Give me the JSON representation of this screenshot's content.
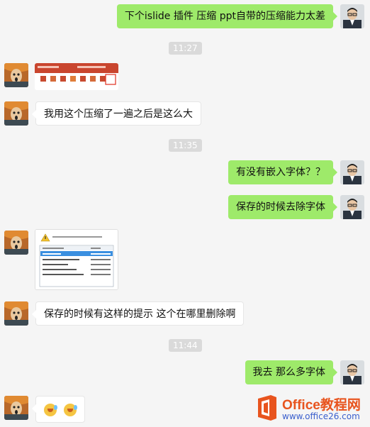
{
  "messages": [
    {
      "side": "me",
      "type": "text",
      "text": "下个islide 插件 压缩 ppt自带的压缩能力太差"
    },
    {
      "type": "time",
      "text": "11:27"
    },
    {
      "side": "other",
      "type": "image",
      "image": "powerpoint-toolbar-screenshot"
    },
    {
      "side": "other",
      "type": "text",
      "text": "我用这个压缩了一遍之后是这么大"
    },
    {
      "type": "time",
      "text": "11:35"
    },
    {
      "side": "me",
      "type": "text",
      "text": "有没有嵌入字体？？"
    },
    {
      "side": "me",
      "type": "text",
      "text": "保存的时候去除字体"
    },
    {
      "side": "other",
      "type": "image",
      "image": "font-warning-dialog-screenshot"
    },
    {
      "side": "other",
      "type": "text",
      "text": "保存的时候有这样的提示 这个在哪里删除啊"
    },
    {
      "type": "time",
      "text": "11:44"
    },
    {
      "side": "me",
      "type": "text",
      "text": "我去 那么多字体"
    },
    {
      "side": "other",
      "type": "emoji",
      "emojis": [
        "grinning-tears-icon",
        "grinning-tears-icon"
      ]
    }
  ],
  "watermark": {
    "logo_icon": "office-logo-icon",
    "title": "Office教程网",
    "url": "www.office26.com",
    "colors": {
      "orange": "#e8541e",
      "blue": "#3a5fcd"
    }
  },
  "colors": {
    "me_bubble": "#9eea6a",
    "other_bubble": "#ffffff",
    "background": "#f5f5f5",
    "time_bg": "#dadada"
  }
}
